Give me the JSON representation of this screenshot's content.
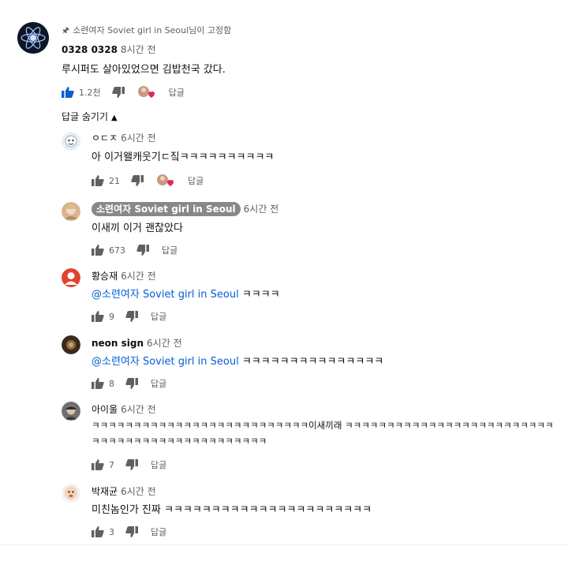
{
  "pinned_label": "소련여자 Soviet girl in Seoul님이 고정함",
  "top_comment": {
    "author": "0328 0328",
    "time": "8시간 전",
    "text": "루시퍼도 살아있었으면 김밥천국 갔다.",
    "likes": "1.2천",
    "reply_label": "답글"
  },
  "hide_replies_label": "답글 숨기기",
  "replies": [
    {
      "author": "ㅇㄷㅈ",
      "time": "6시간 전",
      "text": "아 이거왤캐웃기ㄷ짘ㅋㅋㅋㅋㅋㅋㅋㅋㅋㅋ",
      "likes": "21",
      "reply_label": "답글",
      "hearted": true
    },
    {
      "author": "소련여자 Soviet girl in Seoul",
      "time": "6시간 전",
      "text": "이새끼 이거 괜찮았다",
      "likes": "673",
      "reply_label": "답글",
      "is_creator": true
    },
    {
      "author": "황승재",
      "time": "6시간 전",
      "mention": "@소련여자 Soviet girl in Seoul",
      "text": " ㅋㅋㅋㅋ",
      "likes": "9",
      "reply_label": "답글"
    },
    {
      "author": "neon sign",
      "time": "6시간 전",
      "mention": "@소련여자 Soviet girl in Seoul",
      "text": " ㅋㅋㅋㅋㅋㅋㅋㅋㅋㅋㅋㅋㅋㅋㅋ",
      "likes": "8",
      "reply_label": "답글"
    },
    {
      "author": "아이울",
      "time": "6시간 전",
      "text": "ㅋㅋㅋㅋㅋㅋㅋㅋㅋㅋㅋㅋㅋㅋㅋㅋㅋㅋㅋㅋㅋㅋㅋㅋㅋㅋ이새끼래 ㅋㅋㅋㅋㅋㅋㅋㅋㅋㅋㅋㅋㅋㅋㅋㅋㅋㅋㅋㅋㅋㅋㅋㅋㅋㅋㅋㅋㅋㅋㅋㅋㅋㅋㅋㅋㅋㅋㅋㅋㅋㅋㅋㅋㅋㅋ",
      "likes": "7",
      "reply_label": "답글"
    },
    {
      "author": "박재균",
      "time": "6시간 전",
      "text": "미친놈인가 진짜 ㅋㅋㅋㅋㅋㅋㅋㅋㅋㅋㅋㅋㅋㅋㅋㅋㅋㅋㅋㅋㅋㅋ",
      "likes": "3",
      "reply_label": "답글"
    }
  ],
  "colors": {
    "like_active": "#065fd4",
    "icon": "#606060",
    "mention": "#065fd4",
    "creator_chip": "#888888",
    "heart": "#e0245e"
  },
  "icons": {
    "pin": "pin-icon",
    "like": "thumbs-up-icon",
    "dislike": "thumbs-down-icon",
    "heart": "heart-icon",
    "chevron": "chevron-up-icon"
  }
}
